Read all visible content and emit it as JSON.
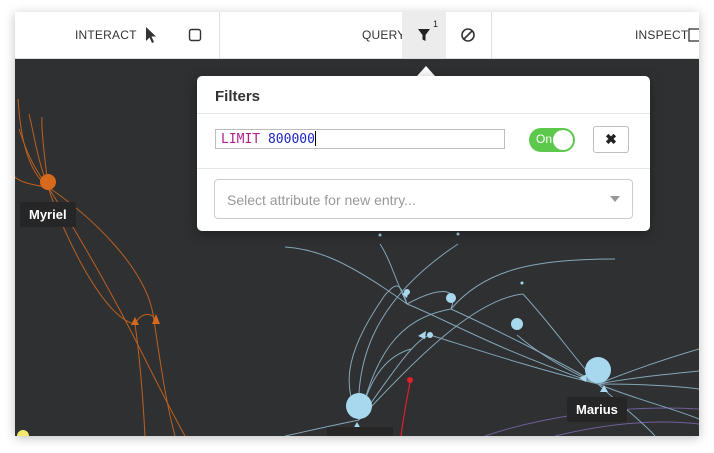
{
  "toolbar": {
    "interact_label": "INTERACT",
    "query_label": "QUERY",
    "inspect_label": "INSPECT",
    "filter_badge": "1",
    "icons": [
      "pointer-icon",
      "select-box-icon",
      "filter-icon",
      "clear-filter-icon",
      "table-icon"
    ]
  },
  "filters_panel": {
    "title": "Filters",
    "query_keyword": "LIMIT",
    "query_value": "800000",
    "toggle_label": "On",
    "remove_label": "✖",
    "select_placeholder": "Select attribute for new entry..."
  },
  "graph": {
    "node_labels": [
      "Myriel",
      "Marius"
    ]
  },
  "colors": {
    "canvas_bg": "#2f3032",
    "toggle_on": "#5cc84c",
    "orange_node": "#d6691c",
    "blue_node": "#a8d8ee"
  }
}
